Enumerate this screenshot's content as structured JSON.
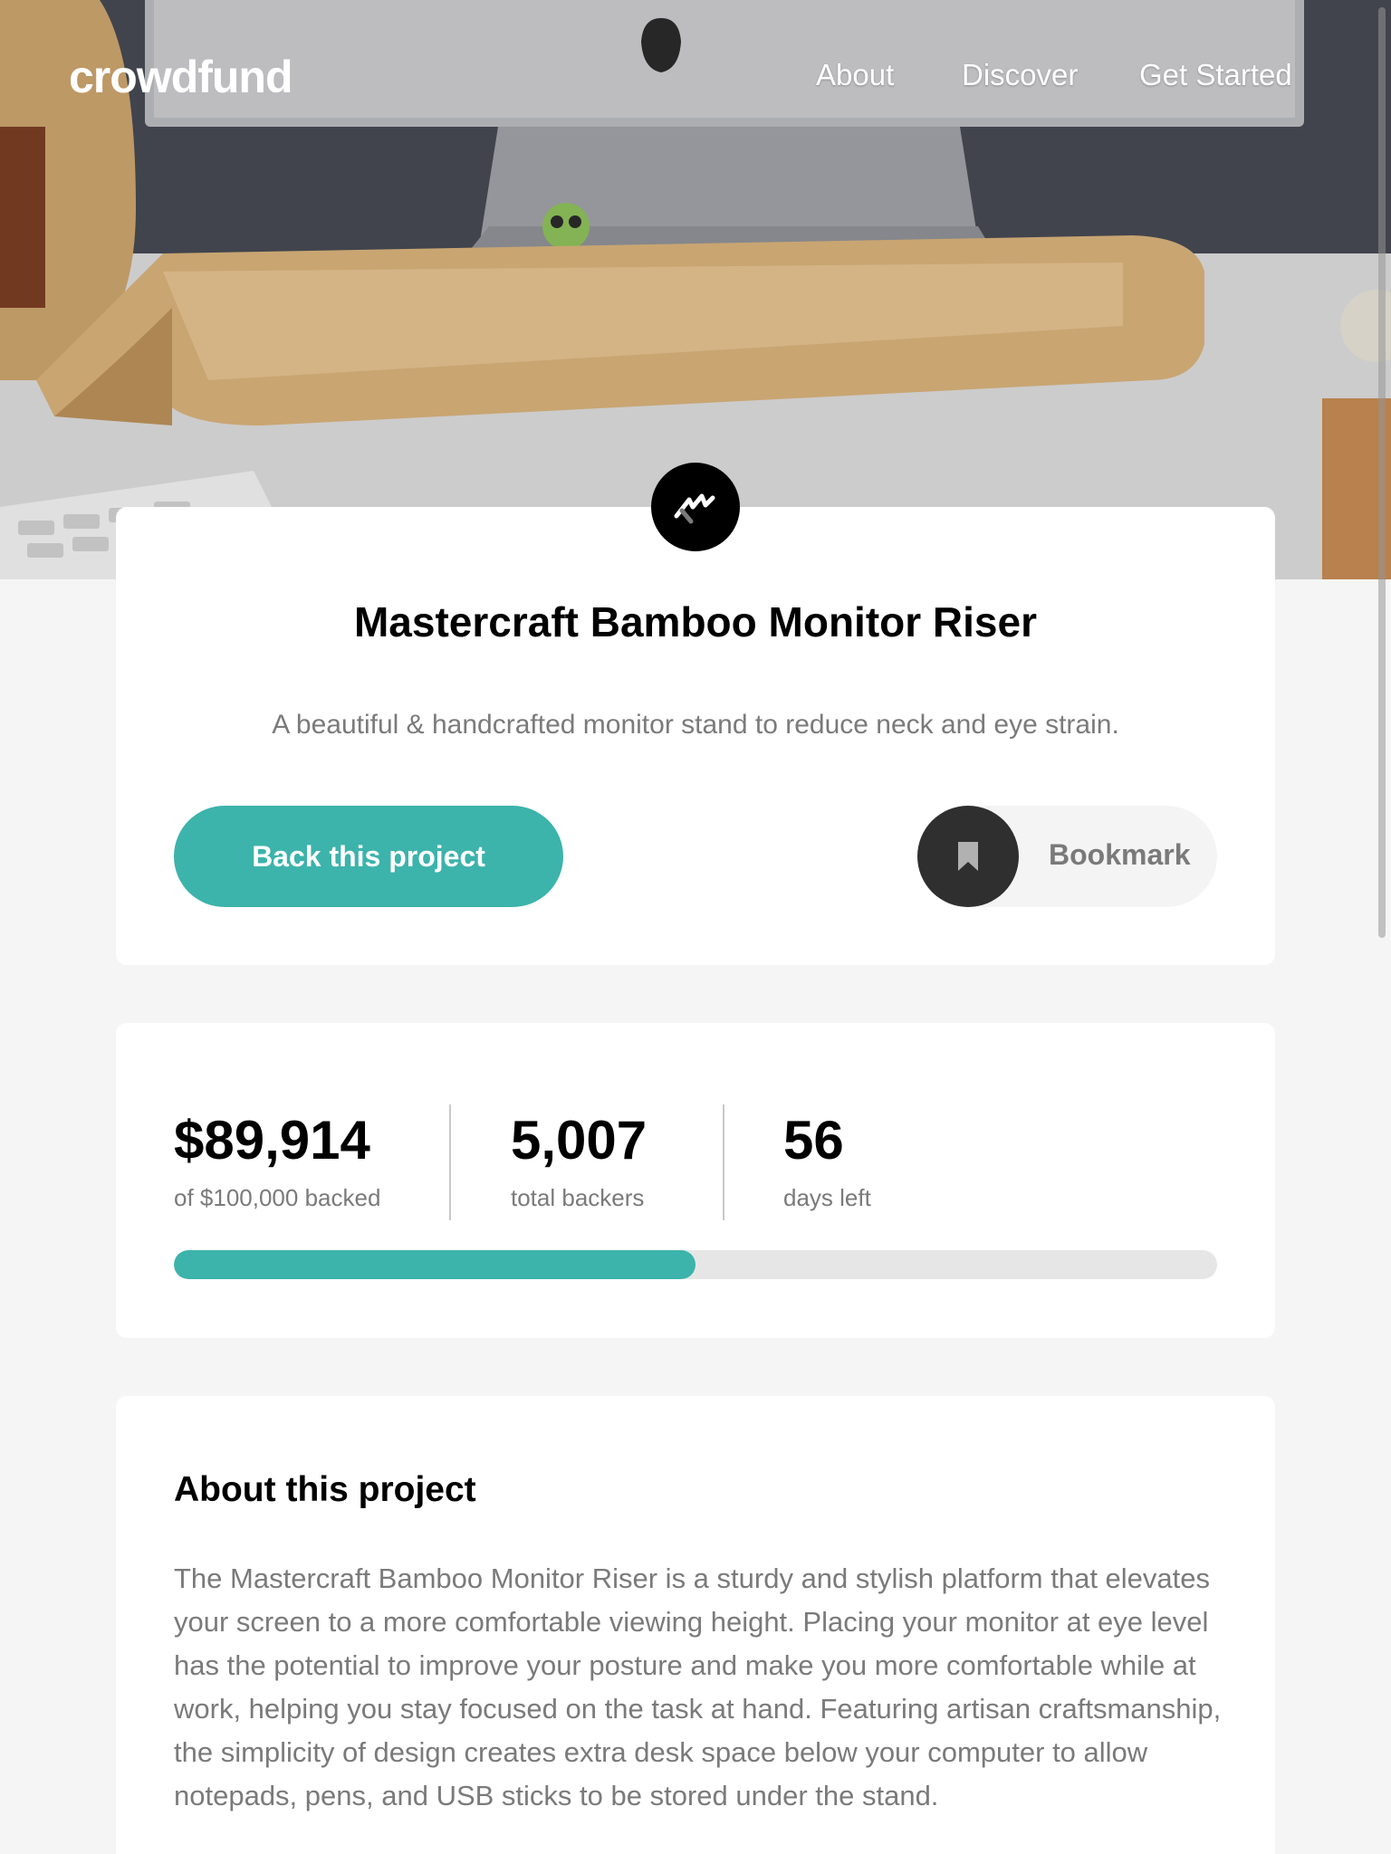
{
  "nav": {
    "logo": "crowdfund",
    "links": [
      "About",
      "Discover",
      "Get Started"
    ]
  },
  "project": {
    "title": "Mastercraft Bamboo Monitor Riser",
    "description": "A beautiful & handcrafted monitor stand to reduce neck and eye strain.",
    "back_label": "Back this project",
    "bookmark_label": "Bookmark"
  },
  "stats": {
    "backed_amount": "$89,914",
    "backed_label": "of $100,000 backed",
    "backers": "5,007",
    "backers_label": "total backers",
    "days": "56",
    "days_label": "days left",
    "progress_fraction": 0.5
  },
  "about": {
    "title": "About this project",
    "body": "The Mastercraft Bamboo Monitor Riser is a sturdy and stylish platform that elevates your screen to a more comfortable viewing height. Placing your monitor at eye level has the potential to improve your posture and make you more comfortable while at work, helping you stay focused on the task at hand. Featuring artisan craftsmanship, the simplicity of design creates extra desk space below your computer to allow notepads, pens, and USB sticks to be stored under the stand."
  },
  "colors": {
    "accent": "#3cb3ab",
    "dark": "#2f2f2f",
    "muted_text": "#7a7a7a",
    "background": "#f5f5f5"
  },
  "icons": {
    "project_logo": "mastercraft-logo-icon",
    "bookmark": "bookmark-icon"
  }
}
